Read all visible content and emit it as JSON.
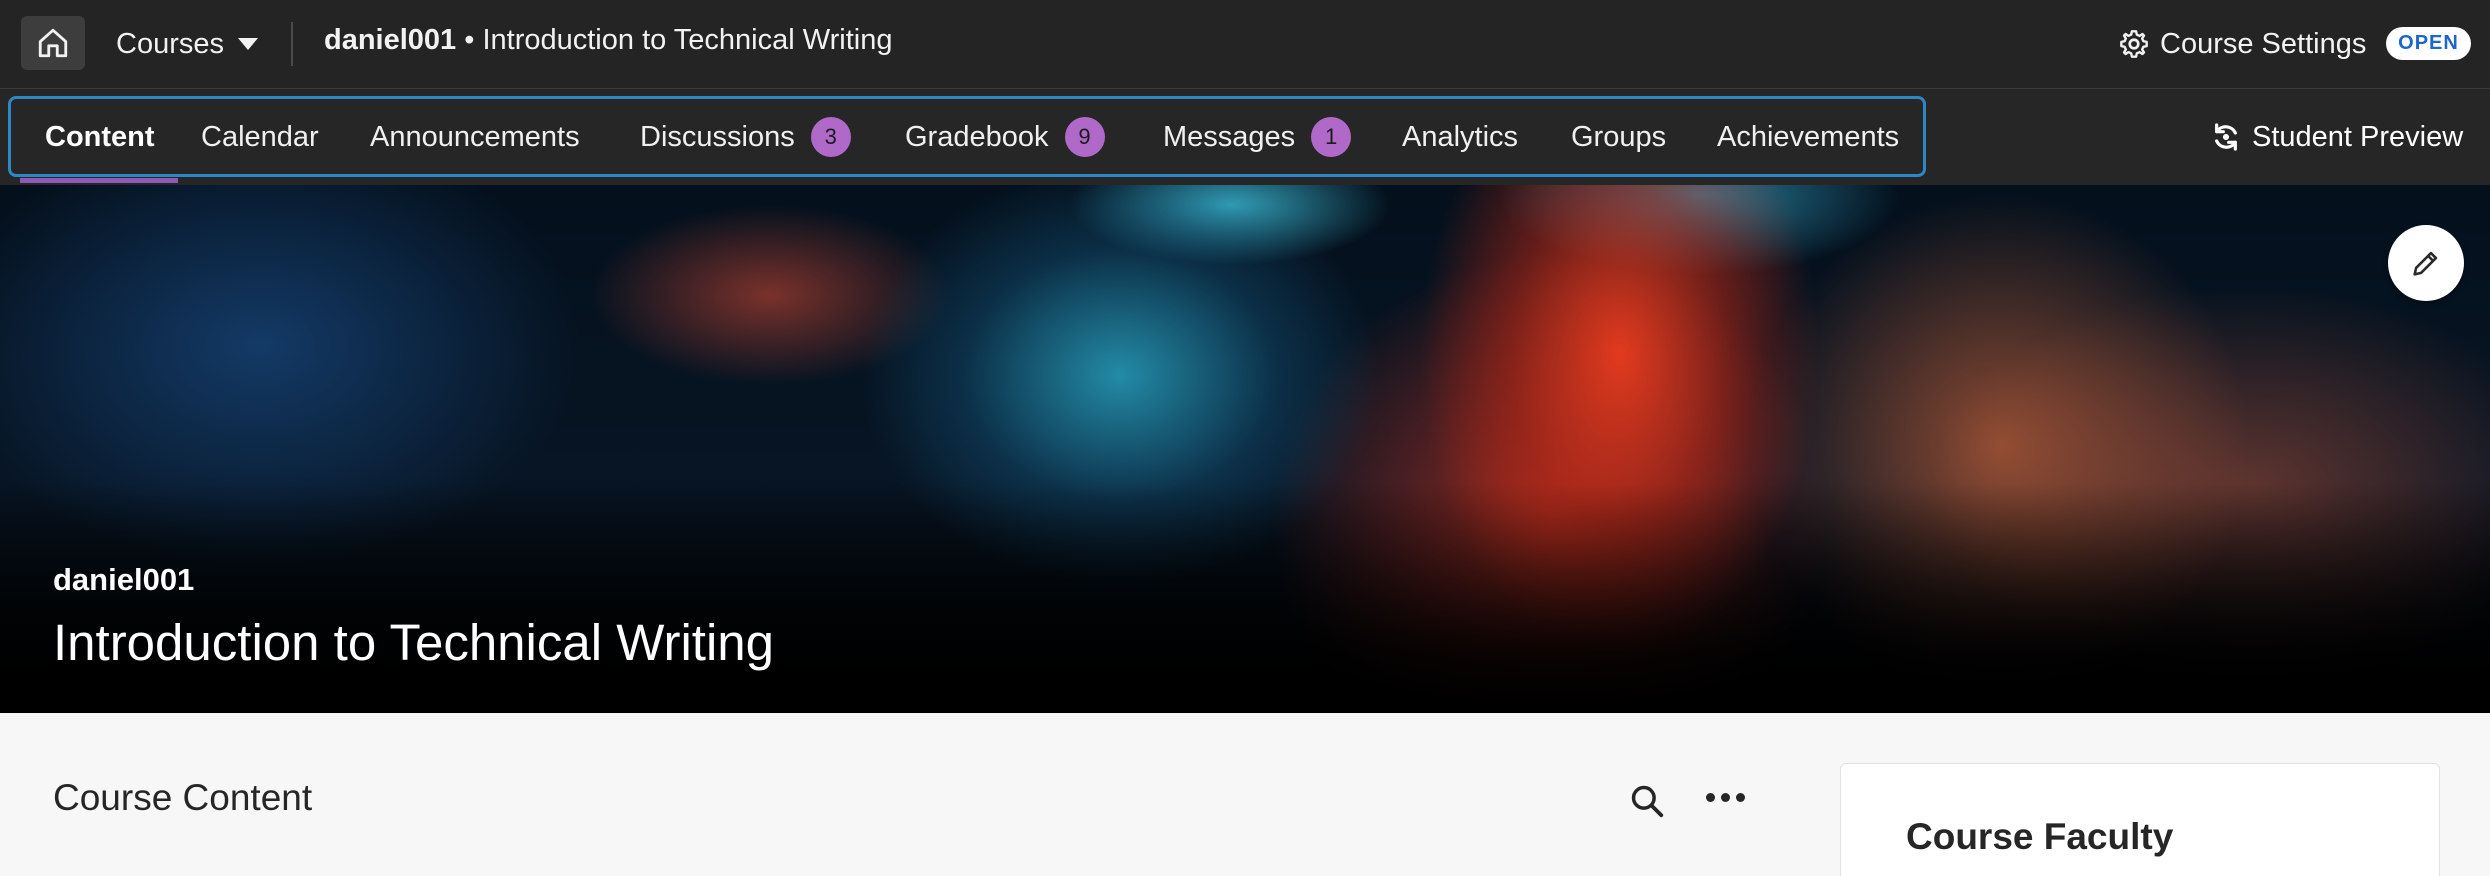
{
  "topbar": {
    "courses_label": "Courses",
    "course_code": "daniel001",
    "course_separator": " • ",
    "course_name": "Introduction to Technical Writing",
    "settings_label": "Course Settings",
    "status_badge": "OPEN"
  },
  "tabs": [
    {
      "label": "Content",
      "active": true
    },
    {
      "label": "Calendar"
    },
    {
      "label": "Announcements"
    },
    {
      "label": "Discussions",
      "badge": "3"
    },
    {
      "label": "Gradebook",
      "badge": "9"
    },
    {
      "label": "Messages",
      "badge": "1"
    },
    {
      "label": "Analytics"
    },
    {
      "label": "Groups"
    },
    {
      "label": "Achievements"
    }
  ],
  "student_preview_label": "Student Preview",
  "banner": {
    "code": "daniel001",
    "title": "Introduction to Technical Writing"
  },
  "content": {
    "title": "Course Content",
    "faculty_title": "Course Faculty"
  },
  "colors": {
    "accent_purple": "#b069c9",
    "focus_blue": "#2d87c5",
    "open_badge_text": "#1d67c6"
  }
}
